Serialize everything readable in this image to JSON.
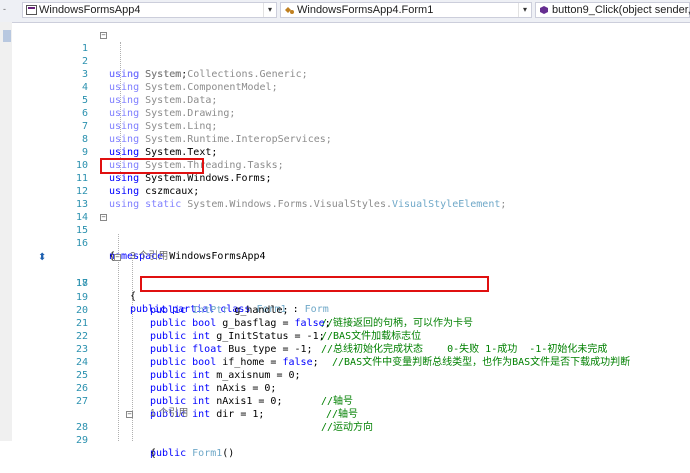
{
  "navbar": {
    "project": "WindowsFormsApp4",
    "class": "WindowsFormsApp4.Form1",
    "member": "button9_Click(object sender, Even"
  },
  "code_lines": [
    {
      "num": "1",
      "text": "using System;",
      "kind": "using"
    },
    {
      "num": "2",
      "text": "using System.Collections.Generic;",
      "kind": "using-dim"
    },
    {
      "num": "3",
      "text": "using System.ComponentModel;",
      "kind": "using-dim"
    },
    {
      "num": "4",
      "text": "using System.Data;",
      "kind": "using-dim"
    },
    {
      "num": "5",
      "text": "using System.Drawing;",
      "kind": "using-dim"
    },
    {
      "num": "6",
      "text": "using System.Linq;",
      "kind": "using-dim"
    },
    {
      "num": "7",
      "text": "using System.Runtime.InteropServices;",
      "kind": "using-dim"
    },
    {
      "num": "8",
      "text": "using System.Text;",
      "kind": "using"
    },
    {
      "num": "9",
      "text": "using System.Threading.Tasks;",
      "kind": "using-dim"
    },
    {
      "num": "10",
      "text": "using System.Windows.Forms;",
      "kind": "using"
    },
    {
      "num": "11",
      "text": "using cszmcaux;",
      "kind": "using"
    },
    {
      "num": "12",
      "text": "using static System.Windows.Forms.VisualStyles.VisualStyleElement;",
      "kind": "using-dim"
    },
    {
      "num": "13",
      "text": "",
      "kind": "blank"
    },
    {
      "num": "14",
      "text": "",
      "kind": "blank"
    },
    {
      "num": "15",
      "text": "namespace WindowsFormsApp4",
      "kind": "namespace"
    },
    {
      "num": "16",
      "text": "{",
      "kind": "brace"
    },
    {
      "num": "",
      "text": "3 个引用",
      "kind": "ref"
    },
    {
      "num": "17",
      "text": "public partial class Form1 : Form",
      "kind": "class"
    },
    {
      "num": "18",
      "text": "{",
      "kind": "brace"
    },
    {
      "num": "19",
      "code": "public IntPtr g_handle;",
      "comment": "//链接返回的句柄，可以作为卡号",
      "kind": "field"
    },
    {
      "num": "20",
      "code": "public bool g_basflag = false;",
      "comment": "//BAS文件加载标志位",
      "kind": "field"
    },
    {
      "num": "21",
      "code": "public int g_InitStatus = -1;",
      "comment": "//总线初始化完成状态    0-失败 1-成功  -1-初始化未完成",
      "kind": "field"
    },
    {
      "num": "22",
      "code": "public float Bus_type = -1;",
      "comment": "//BAS文件中变量判断总线类型，也作为BAS文件是否下载成功判断",
      "kind": "field"
    },
    {
      "num": "23",
      "code": "public bool if_home = false;",
      "comment": "",
      "kind": "field"
    },
    {
      "num": "24",
      "code": "public int m_axisnum = 0;",
      "comment": "",
      "kind": "field"
    },
    {
      "num": "25",
      "code": "public int nAxis = 0;",
      "comment": "//轴号",
      "kind": "field"
    },
    {
      "num": "26",
      "code": "public int nAxis1 = 0;",
      "comment": "//轴号",
      "kind": "field"
    },
    {
      "num": "27",
      "code": "public int dir = 1;",
      "comment": "//运动方向",
      "kind": "field"
    },
    {
      "num": "",
      "text": "1 个引用",
      "kind": "ref"
    },
    {
      "num": "28",
      "text": "public Form1()",
      "kind": "ctor"
    },
    {
      "num": "29",
      "text": "{",
      "kind": "brace"
    }
  ],
  "colors": {
    "keyword": "#0000ff",
    "comment": "#008000",
    "line_number": "#2b91af",
    "highlight_box": "#e01010"
  },
  "icons": {
    "project_icon": "csharp-project-icon",
    "class_icon": "class-icon",
    "member_icon": "method-icon",
    "gutter_glyph": "implementation-glyph-icon"
  }
}
